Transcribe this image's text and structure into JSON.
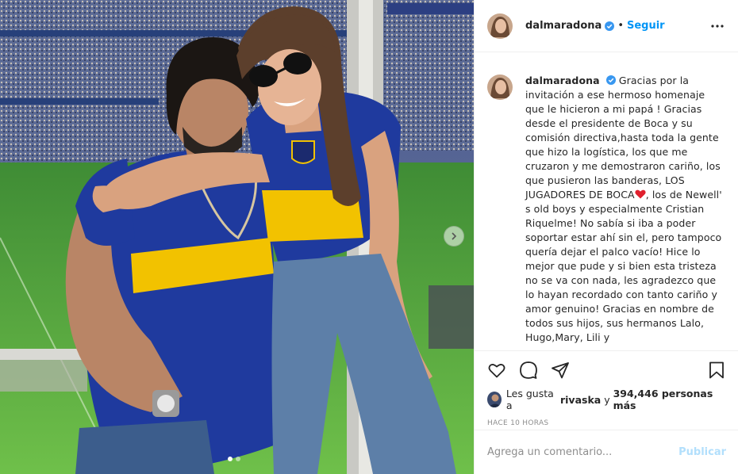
{
  "post": {
    "username": "dalmaradona",
    "verified_icon": "verified-badge-icon",
    "separator": "•",
    "follow_label": "Seguir",
    "more_icon": "more-options-icon"
  },
  "caption": {
    "username": "dalmaradona",
    "text_part1": "Gracias por la invitación a ese hermoso homenaje que le hicieron a mi papá ! Gracias desde el presidente de Boca y su comisión directiva,hasta toda la gente que hizo la logística, los que me cruzaron y me demostraron cariño, los que pusieron las banderas, LOS JUGADORES DE BOCA",
    "text_part2": ", los de Newell' s old boys y especialmente Cristian Riquelme! No sabía si iba a poder soportar estar ahí sin el, pero tampoco quería dejar el palco vacío! Hice lo mejor que pude y si bien esta tristeza no se va con nada, les agradezco que lo hayan recordado con tanto cariño y amor genuino! Gracias en nombre de todos sus hijos, sus hermanos Lalo, Hugo,Mary, Lili y"
  },
  "actions": {
    "like_icon": "heart-icon",
    "comment_icon": "comment-icon",
    "share_icon": "share-icon",
    "save_icon": "bookmark-icon"
  },
  "likes": {
    "prefix": "Les gusta a",
    "liker": "rivaska",
    "connector": "y",
    "count": "394,446 personas más"
  },
  "timestamp": "HACE 10 HORAS",
  "comment": {
    "placeholder": "Agrega un comentario...",
    "publish_label": "Publicar"
  },
  "carousel": {
    "current_index": 1,
    "total": 2
  },
  "colors": {
    "accent": "#0095f6",
    "publish_disabled": "#b2dffc",
    "boca_blue": "#1f3a9e",
    "boca_yellow": "#f2c200"
  }
}
